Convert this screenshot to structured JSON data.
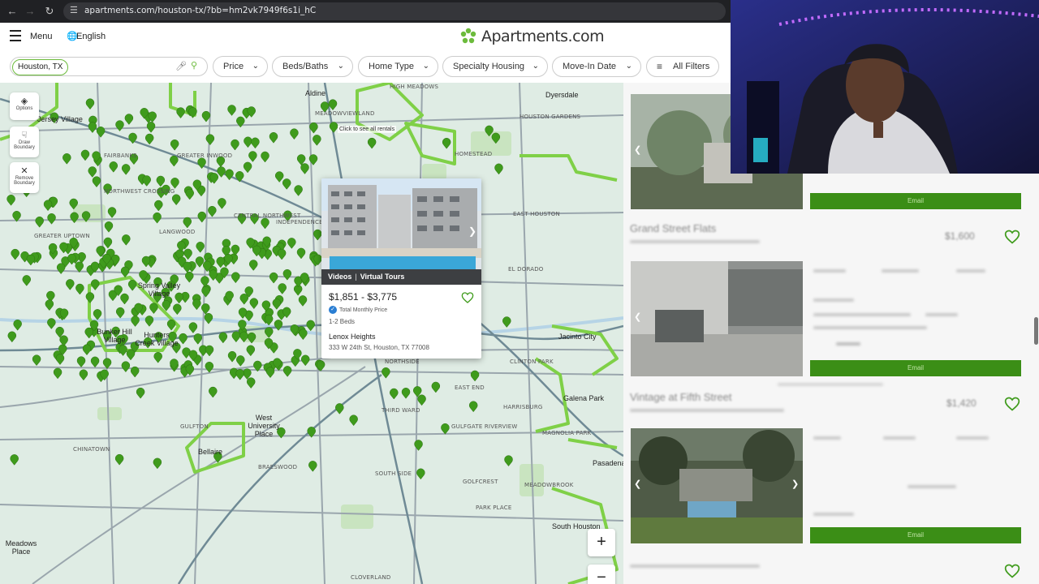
{
  "browser": {
    "url": "apartments.com/houston-tx/?bb=hm2vk7949f6s1i_hC"
  },
  "header": {
    "menu_label": "Menu",
    "language_label": "English",
    "logo_text": "Apartments.com"
  },
  "search": {
    "location": "Houston, TX"
  },
  "filters": {
    "price": "Price",
    "beds_baths": "Beds/Baths",
    "home_type": "Home Type",
    "specialty_housing": "Specialty Housing",
    "move_in_date": "Move-In Date",
    "all_filters": "All Filters"
  },
  "map": {
    "tools": {
      "options": "Options",
      "draw_boundary_1": "Draw",
      "draw_boundary_2": "Boundary",
      "remove_boundary_1": "Remove",
      "remove_boundary_2": "Boundary"
    },
    "click_hint": "Click to see all rentals",
    "zoom_in": "+",
    "zoom_out": "−",
    "labels": {
      "jersey_village": "Jersey Village",
      "aldine": "Aldine",
      "dyersdale": "Dyersdale",
      "high_meadows": "HIGH MEADOWS",
      "meadowview": "MEADOWVIEWLAND",
      "houston_gardens": "HOUSTON GARDENS",
      "east_houston": "EAST HOUSTON",
      "homestead": "HOMESTEAD",
      "fairbanks": "FAIRBANKS",
      "northwest_crossing": "NORTHWEST CROSSING",
      "greater_inwood": "GREATER INWOOD",
      "central_northwest": "CENTRAL NORTHWEST",
      "langwood": "LANGWOOD",
      "spring_valley": "Spring Valley Village",
      "bunker_hill": "Bunker Hill Village",
      "hunters_creek": "Hunters Creek Village",
      "jacinto_city": "Jacinto City",
      "galena_park": "Galena Park",
      "west_univ": "West University Place",
      "bellaire": "Bellaire",
      "chinatown": "CHINATOWN",
      "braeswood": "BRAESWOOD",
      "third_ward": "THIRD WARD",
      "south_side": "SOUTH SIDE",
      "south_houston": "South Houston",
      "meadows_place": "Meadows Place",
      "cloverland": "CLOVERLAND",
      "pasadena": "Pasadena",
      "harrisburg": "HARRISBURG",
      "clinton_park": "CLINTON PARK",
      "eldorado": "EL DORADO",
      "gulfgate": "GULFGATE RIVERVIEW",
      "meadowbrook": "MEADOWBROOK",
      "park_place": "PARK PLACE",
      "golfcrest": "GOLFCREST",
      "gulfton": "GULFTON",
      "greater_uptown": "GREATER UPTOWN",
      "independence_heights": "INDEPENDENCE HEIGHTS",
      "east_end": "EAST END",
      "northside": "NORTHSIDE",
      "magnolia_park": "MAGNOLIA PARK"
    }
  },
  "popup": {
    "badge_videos": "Videos",
    "badge_tours": "Virtual Tours",
    "price": "$1,851 - $3,775",
    "verified": "Total Monthly Price",
    "beds": "1-2 Beds",
    "name": "Lenox Heights",
    "address": "333 W 24th St, Houston, TX 77008"
  },
  "listings": [
    {
      "title": "",
      "subtitle": "",
      "price": "",
      "button": "Email"
    },
    {
      "title": "Grand Street Flats",
      "subtitle": "",
      "price": "$1,600",
      "button": "Email"
    },
    {
      "title": "Vintage at Fifth Street",
      "subtitle": "",
      "price": "$1,420",
      "button": "Email"
    }
  ],
  "colors": {
    "brand_green": "#6cbb3c",
    "pin_green": "#3f9b1c",
    "button_green": "#3b8e16"
  }
}
